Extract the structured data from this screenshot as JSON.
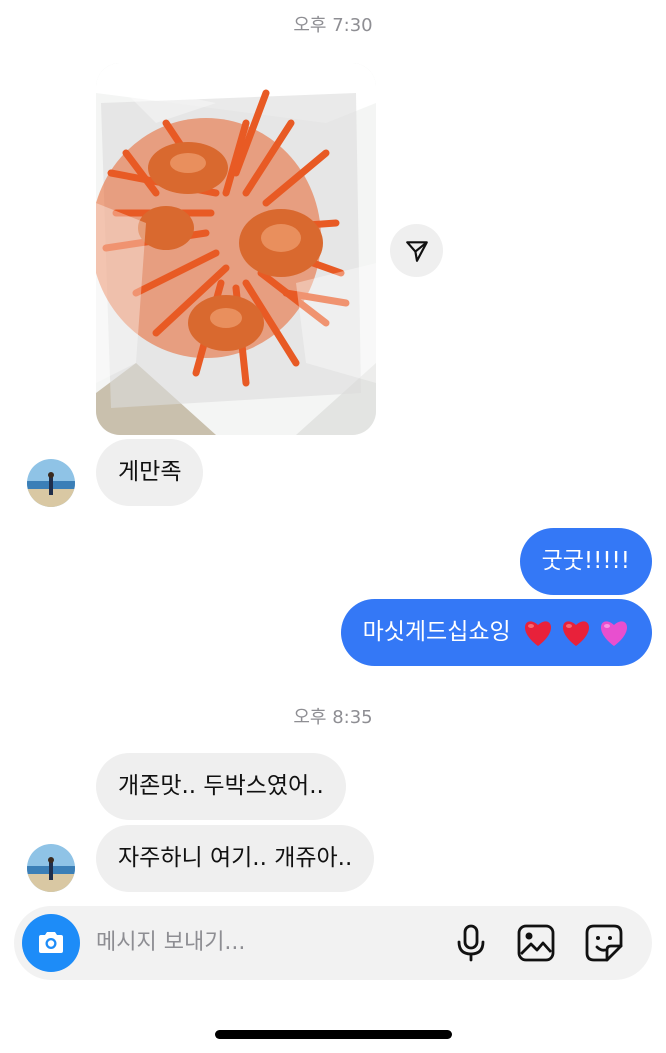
{
  "conversation": {
    "timestamp_1": "오후 7:30",
    "timestamp_2": "오후 8:35"
  },
  "messages": [
    {
      "id": "msg1",
      "direction": "incoming",
      "text": "게만족"
    },
    {
      "id": "msg2",
      "direction": "outgoing",
      "text": "굿굿!!!!!"
    },
    {
      "id": "msg3",
      "direction": "outgoing",
      "text": "마싯게드십쇼잉",
      "emoji": [
        "red-heart",
        "red-heart",
        "pink-heart"
      ]
    },
    {
      "id": "msg4",
      "direction": "incoming",
      "text": "개존맛.. 두박스였어.."
    },
    {
      "id": "msg5",
      "direction": "incoming",
      "text": "자주하니 여기.. 개쥬아.."
    }
  ],
  "composer": {
    "placeholder": "메시지 보내기..."
  },
  "colors": {
    "outgoing_bubble": "#3478f6",
    "incoming_bubble": "#efefef",
    "camera_button": "#1d8cf8",
    "heart_red": "#e8213a",
    "heart_pink": "#e84fcf"
  },
  "icons": [
    "send-icon",
    "camera-icon",
    "microphone-icon",
    "gallery-icon",
    "sticker-icon"
  ]
}
